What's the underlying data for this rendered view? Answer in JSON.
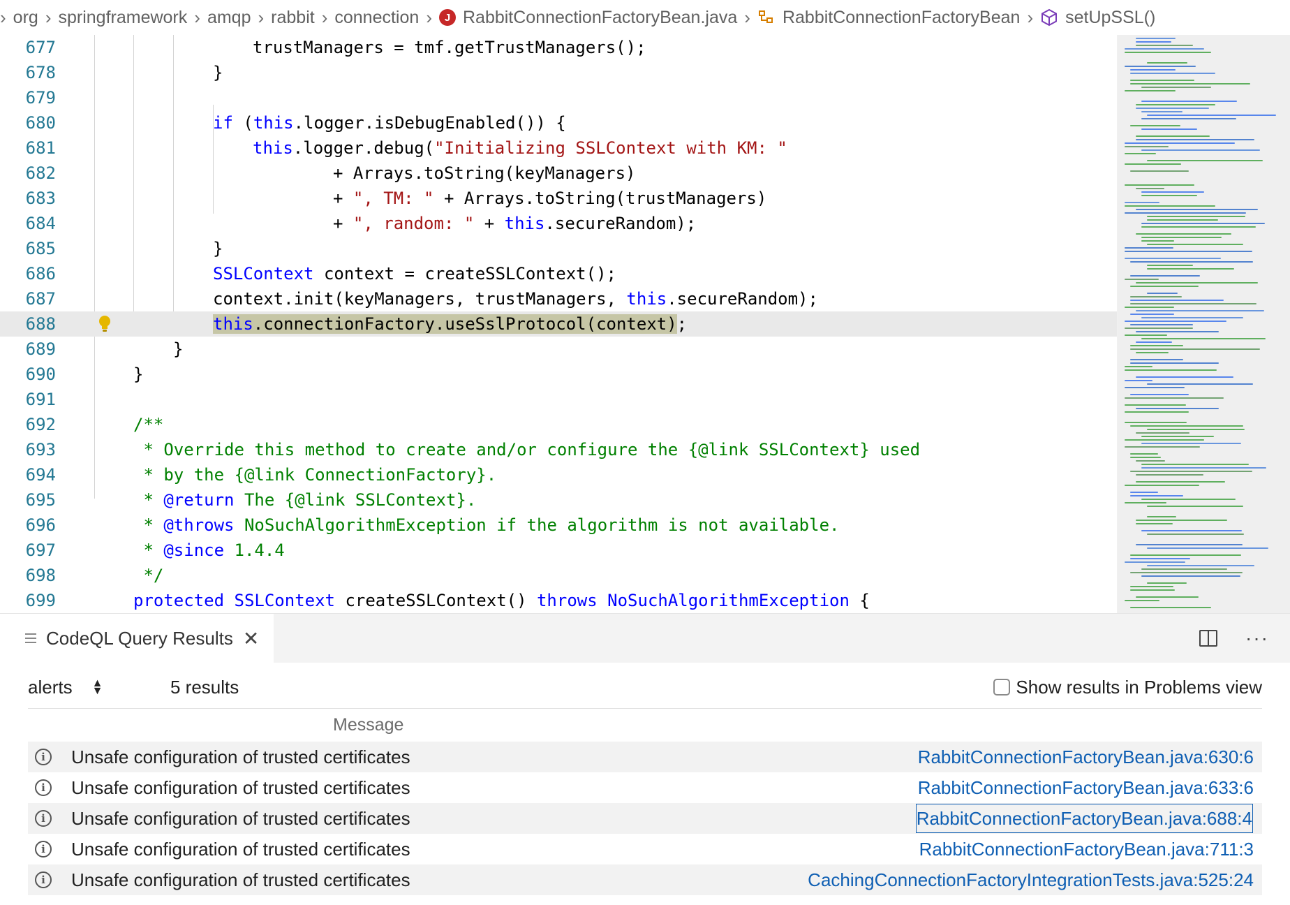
{
  "breadcrumb": {
    "items": [
      "org",
      "springframework",
      "amqp",
      "rabbit",
      "connection"
    ],
    "file": "RabbitConnectionFactoryBean.java",
    "file_icon_letter": "J",
    "class_name": "RabbitConnectionFactoryBean",
    "method_name": "setUpSSL()"
  },
  "editor": {
    "line_numbers": [
      "677",
      "678",
      "679",
      "680",
      "681",
      "682",
      "683",
      "684",
      "685",
      "686",
      "687",
      "688",
      "689",
      "690",
      "691",
      "692",
      "693",
      "694",
      "695",
      "696",
      "697",
      "698",
      "699"
    ],
    "current_line": "688"
  },
  "code": {
    "l677": "trustManagers = tmf.getTrustManagers();",
    "l678": "}",
    "l680_kw": "if",
    "l680_a": " (",
    "l680_this": "this",
    "l680_b": ".logger.isDebugEnabled()) {",
    "l681_this": "this",
    "l681_a": ".logger.debug(",
    "l681_str": "\"Initializing SSLContext with KM: \"",
    "l682": "+ Arrays.toString(keyManagers)",
    "l683_a": "+ ",
    "l683_str": "\", TM: \"",
    "l683_b": " + Arrays.toString(trustManagers)",
    "l684_a": "+ ",
    "l684_str": "\", random: \"",
    "l684_b": " + ",
    "l684_this": "this",
    "l684_c": ".secureRandom);",
    "l685": "}",
    "l686_type": "SSLContext",
    "l686_rest": " context = createSSLContext();",
    "l687_a": "context.init(keyManagers, trustManagers, ",
    "l687_this": "this",
    "l687_b": ".secureRandom);",
    "l688_this": "this",
    "l688_a": ".connectionFactory.useSslProtocol(context)",
    "l688_b": ";",
    "l689": "}",
    "l690": "}",
    "l692": "/**",
    "l693": " * Override this method to create and/or configure the {@link SSLContext} used",
    "l694": " * by the {@link ConnectionFactory}.",
    "l695_a": " * ",
    "l695_tag": "@return",
    "l695_b": " The {@link SSLContext}.",
    "l696_a": " * ",
    "l696_tag": "@throws",
    "l696_b": " NoSuchAlgorithmException if the algorithm is not available.",
    "l697_a": " * ",
    "l697_tag": "@since",
    "l697_b": " 1.4.4",
    "l698": " */",
    "l699_kw": "protected",
    "l699_sp1": " ",
    "l699_type": "SSLContext",
    "l699_mid": " createSSLContext() ",
    "l699_kw2": "throws",
    "l699_sp2": " ",
    "l699_type2": "NoSuchAlgorithmException",
    "l699_end": " {"
  },
  "panel": {
    "tab_title": "CodeQL Query Results",
    "tab_close": "✕",
    "more": "···",
    "select_value": "alerts",
    "result_count": "5 results",
    "problems_label": "Show results in Problems view",
    "column_message": "Message",
    "results": [
      {
        "message": "Unsafe configuration of trusted certificates",
        "location": "RabbitConnectionFactoryBean.java:630:6"
      },
      {
        "message": "Unsafe configuration of trusted certificates",
        "location": "RabbitConnectionFactoryBean.java:633:6"
      },
      {
        "message": "Unsafe configuration of trusted certificates",
        "location": "RabbitConnectionFactoryBean.java:688:4"
      },
      {
        "message": "Unsafe configuration of trusted certificates",
        "location": "RabbitConnectionFactoryBean.java:711:3"
      },
      {
        "message": "Unsafe configuration of trusted certificates",
        "location": "CachingConnectionFactoryIntegrationTests.java:525:24"
      }
    ]
  },
  "colors": {
    "keyword": "#0000ff",
    "string": "#a31515",
    "comment": "#008000",
    "line_number": "#237893",
    "link": "#0f5fb3",
    "highlight": "#c6c6a6"
  }
}
